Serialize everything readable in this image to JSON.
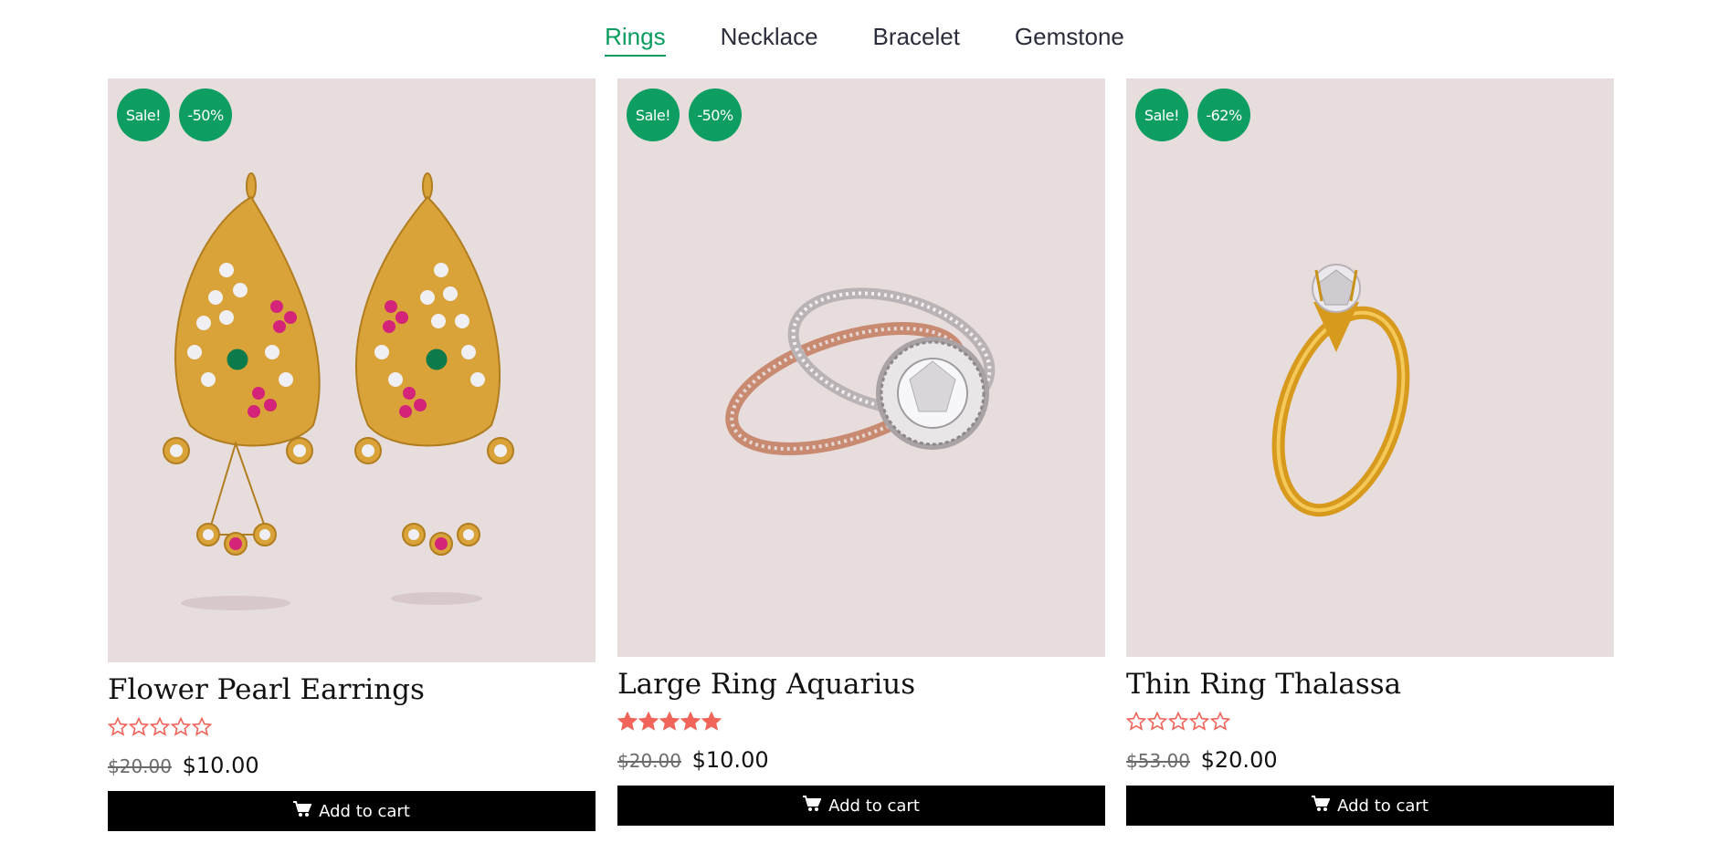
{
  "tabs": [
    "Rings",
    "Necklace",
    "Bracelet",
    "Gemstone"
  ],
  "active_tab": "Rings",
  "products": [
    {
      "title": "Flower Pearl Earrings",
      "badge_sale": "Sale!",
      "badge_discount": "-50%",
      "rating": 0,
      "old_price": "$20.00",
      "price": "$10.00",
      "cart_label": "Add to cart",
      "image": "earrings-image"
    },
    {
      "title": "Large Ring Aquarius",
      "badge_sale": "Sale!",
      "badge_discount": "-50%",
      "rating": 5,
      "old_price": "$20.00",
      "price": "$10.00",
      "cart_label": "Add to cart",
      "image": "double-ring-image"
    },
    {
      "title": "Thin Ring Thalassa",
      "badge_sale": "Sale!",
      "badge_discount": "-62%",
      "rating": 0,
      "old_price": "$53.00",
      "price": "$20.00",
      "cart_label": "Add to cart",
      "image": "solitaire-ring-image"
    }
  ],
  "colors": {
    "accent": "#0a9b5f",
    "badge": "#0e9e61",
    "star": "#f0645a",
    "image_bg": "#e8dddd",
    "button_bg": "#000000"
  },
  "icons": {
    "cart": "cart-icon",
    "star": "star-icon"
  }
}
